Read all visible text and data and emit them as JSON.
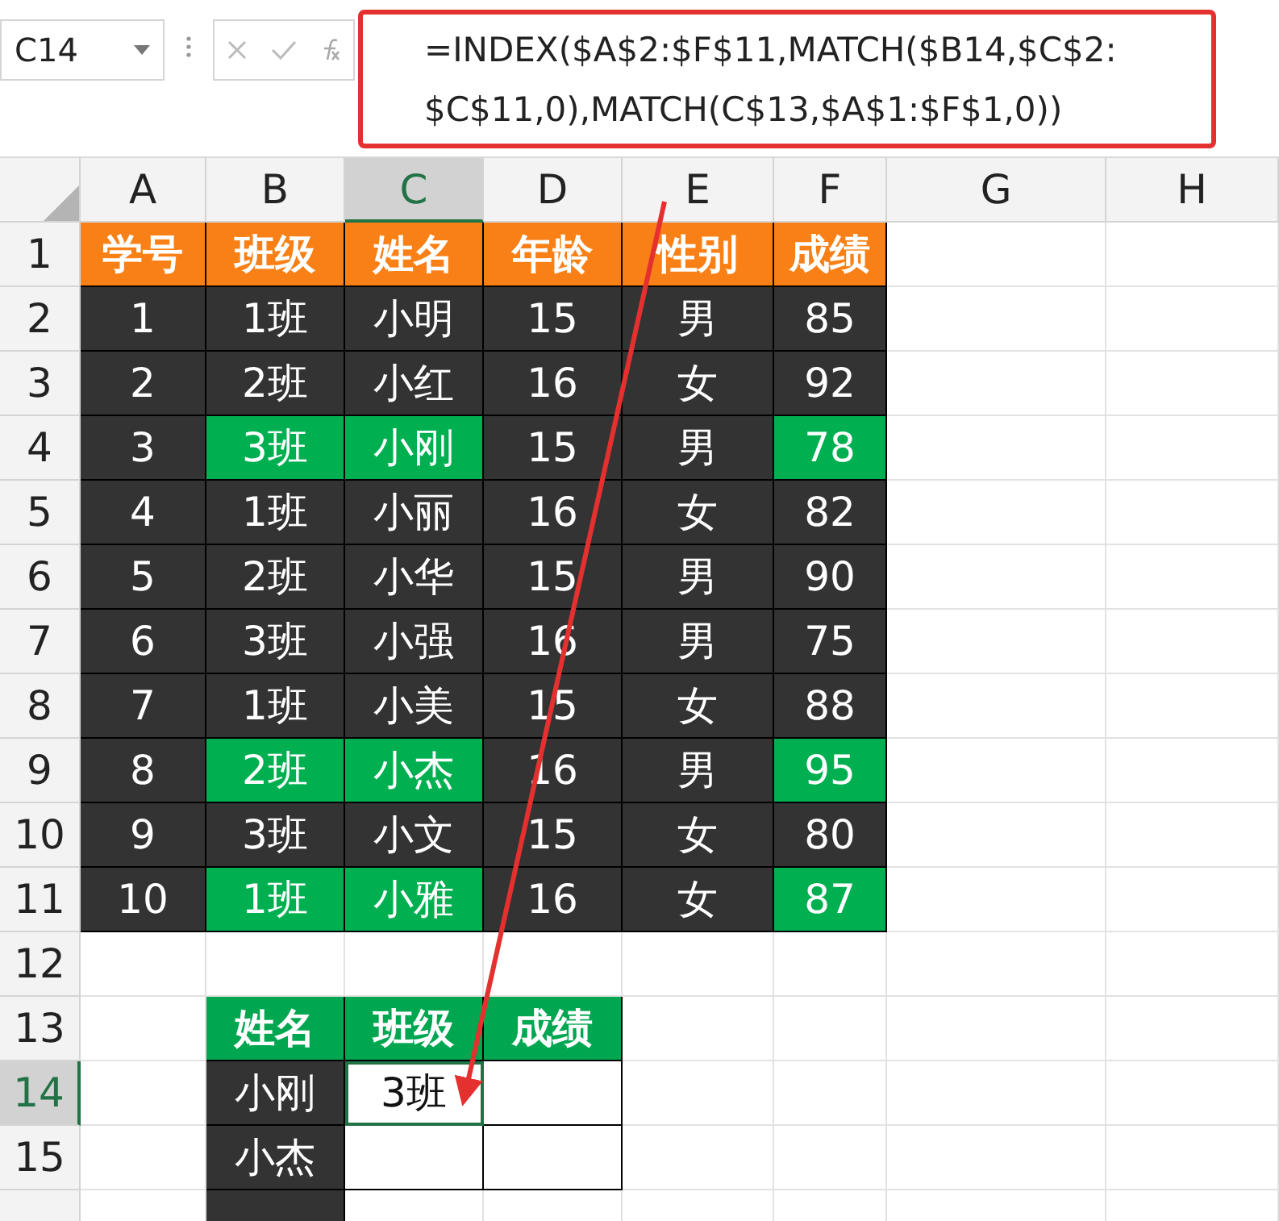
{
  "formula_bar": {
    "name_box": "C14",
    "formula_lines": [
      "=INDEX($A$2:$F$11,MATCH($B14,$C$2:",
      "$C$11,0),MATCH(C$13,$A$1:$F$1,0))"
    ],
    "highlighted": true
  },
  "columns": [
    {
      "label": "A",
      "selected": false
    },
    {
      "label": "B",
      "selected": false
    },
    {
      "label": "C",
      "selected": true
    },
    {
      "label": "D",
      "selected": false
    },
    {
      "label": "E",
      "selected": false
    },
    {
      "label": "F",
      "selected": false
    },
    {
      "label": "G",
      "selected": false
    },
    {
      "label": "H",
      "selected": false
    }
  ],
  "row_numbers": [
    {
      "label": "1",
      "selected": false
    },
    {
      "label": "2",
      "selected": false
    },
    {
      "label": "3",
      "selected": false
    },
    {
      "label": "4",
      "selected": false
    },
    {
      "label": "5",
      "selected": false
    },
    {
      "label": "6",
      "selected": false
    },
    {
      "label": "7",
      "selected": false
    },
    {
      "label": "8",
      "selected": false
    },
    {
      "label": "9",
      "selected": false
    },
    {
      "label": "10",
      "selected": false
    },
    {
      "label": "11",
      "selected": false
    },
    {
      "label": "12",
      "selected": false
    },
    {
      "label": "13",
      "selected": false
    },
    {
      "label": "14",
      "selected": true
    },
    {
      "label": "15",
      "selected": false
    }
  ],
  "main_table": {
    "header": [
      "学号",
      "班级",
      "姓名",
      "年龄",
      "性别",
      "成绩"
    ],
    "rows": [
      {
        "cells": [
          "1",
          "1班",
          "小明",
          "15",
          "男",
          "85"
        ],
        "highlighted": false
      },
      {
        "cells": [
          "2",
          "2班",
          "小红",
          "16",
          "女",
          "92"
        ],
        "highlighted": false
      },
      {
        "cells": [
          "3",
          "3班",
          "小刚",
          "15",
          "男",
          "78"
        ],
        "highlighted": true
      },
      {
        "cells": [
          "4",
          "1班",
          "小丽",
          "16",
          "女",
          "82"
        ],
        "highlighted": false
      },
      {
        "cells": [
          "5",
          "2班",
          "小华",
          "15",
          "男",
          "90"
        ],
        "highlighted": false
      },
      {
        "cells": [
          "6",
          "3班",
          "小强",
          "16",
          "男",
          "75"
        ],
        "highlighted": false
      },
      {
        "cells": [
          "7",
          "1班",
          "小美",
          "15",
          "女",
          "88"
        ],
        "highlighted": false
      },
      {
        "cells": [
          "8",
          "2班",
          "小杰",
          "16",
          "男",
          "95"
        ],
        "highlighted": true
      },
      {
        "cells": [
          "9",
          "3班",
          "小文",
          "15",
          "女",
          "80"
        ],
        "highlighted": false
      },
      {
        "cells": [
          "10",
          "1班",
          "小雅",
          "16",
          "女",
          "87"
        ],
        "highlighted": true
      }
    ]
  },
  "lookup_table": {
    "header": [
      "姓名",
      "班级",
      "成绩"
    ],
    "rows": [
      {
        "name": "小刚",
        "class": "3班",
        "selected": true
      },
      {
        "name": "小杰",
        "selected": false
      }
    ]
  }
}
